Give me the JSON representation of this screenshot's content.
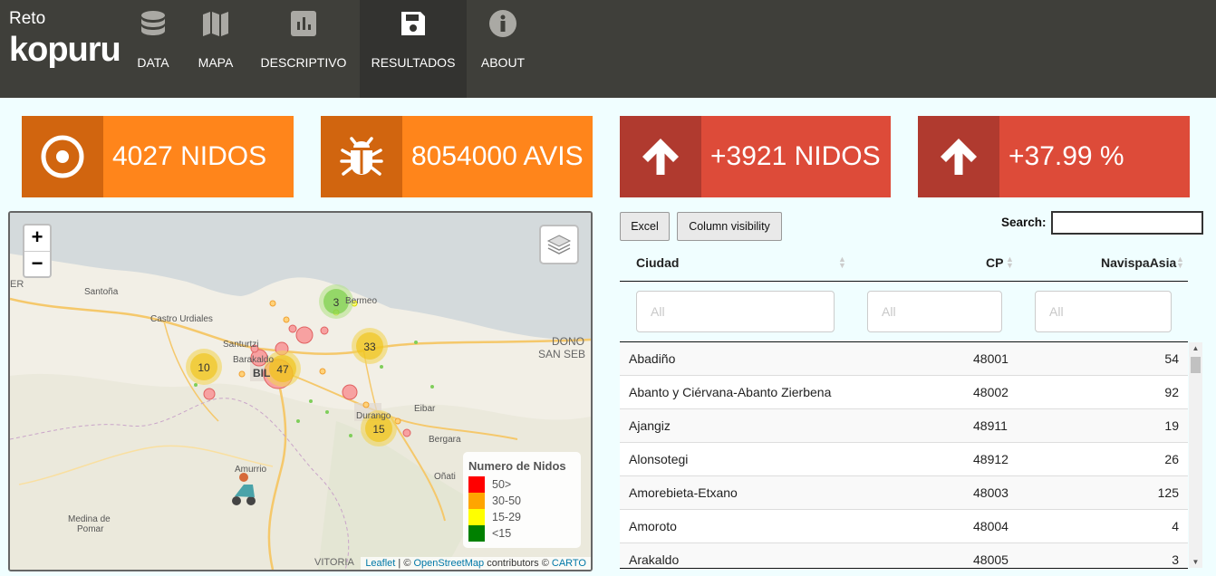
{
  "brand": {
    "reto": "Reto",
    "name": "kopuru"
  },
  "nav": [
    {
      "label": "DATA",
      "icon": "database-icon"
    },
    {
      "label": "MAPA",
      "icon": "map-icon"
    },
    {
      "label": "DESCRIPTIVO",
      "icon": "bar-chart-icon"
    },
    {
      "label": "RESULTADOS",
      "icon": "save-icon",
      "active": true
    },
    {
      "label": "ABOUT",
      "icon": "info-icon"
    }
  ],
  "stats": [
    {
      "text": "4027 NIDOS",
      "icon": "bullseye-icon",
      "color": "#ff851b"
    },
    {
      "text": "8054000 AVIS",
      "icon": "bug-icon",
      "color": "#ff851b"
    },
    {
      "text": "+3921 NIDOS",
      "icon": "arrow-up-icon",
      "color": "#dd4b39"
    },
    {
      "text": "+37.99 %",
      "icon": "arrow-up-icon",
      "color": "#dd4b39"
    }
  ],
  "map": {
    "zoom_in": "+",
    "zoom_out": "−",
    "places": [
      "Santoña",
      "Castro Urdiales",
      "Santurtzi",
      "Barakaldo",
      "BIL",
      "Bermeo",
      "Durango",
      "Eibar",
      "Bergara",
      "Amurrio",
      "Oñati",
      "Medina de",
      "Pomar",
      "DONO",
      "SAN SEB",
      "VITORIA",
      "ER"
    ],
    "clusters": [
      "3",
      "33",
      "10",
      "47",
      "15"
    ],
    "legend": {
      "title": "Numero de Nidos",
      "items": [
        {
          "label": "50>",
          "color": "#ff0000"
        },
        {
          "label": "30-50",
          "color": "#ffa500"
        },
        {
          "label": "15-29",
          "color": "#ffff00"
        },
        {
          "label": "<15",
          "color": "#008000"
        }
      ]
    },
    "attribution": {
      "leaflet": "Leaflet",
      "sep": " | © ",
      "osm": "OpenStreetMap",
      "contrib": " contributors © ",
      "carto": "CARTO"
    }
  },
  "table": {
    "buttons": {
      "excel": "Excel",
      "colvis": "Column visibility"
    },
    "search_label": "Search:",
    "columns": [
      "Ciudad",
      "CP",
      "NavispaAsia"
    ],
    "filter_placeholder": "All",
    "rows": [
      [
        "Abadiño",
        "48001",
        "54"
      ],
      [
        "Abanto y Ciérvana-Abanto Zierbena",
        "48002",
        "92"
      ],
      [
        "Ajangiz",
        "48911",
        "19"
      ],
      [
        "Alonsotegi",
        "48912",
        "26"
      ],
      [
        "Amorebieta-Etxano",
        "48003",
        "125"
      ],
      [
        "Amoroto",
        "48004",
        "4"
      ],
      [
        "Arakaldo",
        "48005",
        "3"
      ]
    ]
  }
}
